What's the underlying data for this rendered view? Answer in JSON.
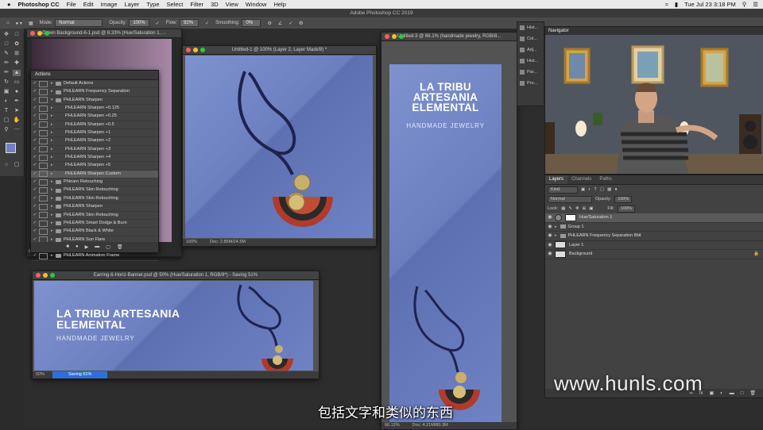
{
  "menubar": {
    "apple": "",
    "app_name": "Photoshop CC",
    "items": [
      "File",
      "Edit",
      "Image",
      "Layer",
      "Type",
      "Select",
      "Filter",
      "3D",
      "View",
      "Window",
      "Help"
    ],
    "clock": "Tue Jul 23  3:18 PM"
  },
  "window_title": "Adobe Photoshop CC 2019",
  "options_bar": {
    "mode_label": "Mode:",
    "mode_value": "Normal",
    "opacity_label": "Opacity:",
    "opacity_value": "100%",
    "flow_label": "Flow:",
    "flow_value": "92%",
    "smoothing_label": "Smoothing:",
    "smoothing_value": "0%"
  },
  "documents": {
    "green_bg": {
      "title": "Green Background-6-1.psd @ 8.33% (Hue/Saturation 1, ...",
      "zoom": "8.33%"
    },
    "untitled1": {
      "title": "Untitled-1 @ 100% (Layer 2, Layer Mask/8) *",
      "zoom": "100%",
      "doc": "Doc: 2.85M/24.5M"
    },
    "untitled3": {
      "title": "Untitled-3 @ 66.1% (handmade jewelry, RGB/8...",
      "zoom": "66.12%",
      "doc": "Doc: 4.21M/80.3M"
    },
    "banner": {
      "title": "Earring-6-Horiz-Banner.psd @ 50% (Hue/Saturation 1, RGB/8*) - Saving 51%",
      "zoom": "50%",
      "saving": "Saving 51%"
    }
  },
  "brand": {
    "title_vertical": "LA TRIBU ARTESANIA ELEMENTAL",
    "title_banner": "LA TRIBU ARTESANIA ELEMENTAL",
    "subtitle": "HANDMADE JEWELRY"
  },
  "actions_panel": {
    "title": "Actions",
    "rows": [
      {
        "label": "Default Actions",
        "kind": "set"
      },
      {
        "label": "PHLEARN Frequency Separation",
        "kind": "set"
      },
      {
        "label": "PHLEARN Sharpen",
        "kind": "set-open"
      },
      {
        "label": "PHLEARN Sharpen +0.125",
        "kind": "action"
      },
      {
        "label": "PHLEARN Sharpen +0.25",
        "kind": "action"
      },
      {
        "label": "PHLEARN Sharpen +0.5",
        "kind": "action"
      },
      {
        "label": "PHLEARN Sharpen +1",
        "kind": "action"
      },
      {
        "label": "PHLEARN Sharpen +2",
        "kind": "action"
      },
      {
        "label": "PHLEARN Sharpen +3",
        "kind": "action"
      },
      {
        "label": "PHLEARN Sharpen +4",
        "kind": "action"
      },
      {
        "label": "PHLEARN Sharpen +5",
        "kind": "action"
      },
      {
        "label": "PHLEARN Sharpen Custom",
        "kind": "action-sel"
      },
      {
        "label": "Phlearn Retouching",
        "kind": "set"
      },
      {
        "label": "PHLEARN Skin Retouching",
        "kind": "set"
      },
      {
        "label": "PHLEARN Skin Retouching",
        "kind": "set"
      },
      {
        "label": "PHLEARN Sharpen",
        "kind": "set"
      },
      {
        "label": "PHLEARN Skin Retouching",
        "kind": "set"
      },
      {
        "label": "PHLEARN Smart Dodge & Burn",
        "kind": "set"
      },
      {
        "label": "PHLEARN Black & White",
        "kind": "set"
      },
      {
        "label": "PHLEARN Sun Flare",
        "kind": "set"
      },
      {
        "label": "PHLEARN Sharpen",
        "kind": "set"
      },
      {
        "label": "PHLEARN Animation Frame",
        "kind": "set"
      }
    ],
    "footer_buttons": [
      "■",
      "●",
      "▶",
      "▬",
      "▢",
      "🗑"
    ]
  },
  "dock": {
    "items": [
      "Hist...",
      "Col...",
      "Adj...",
      "Hist...",
      "Par...",
      "Pro..."
    ]
  },
  "navigator": {
    "title": "Navigator"
  },
  "layers_panel": {
    "tabs": [
      "Layers",
      "Channels",
      "Paths"
    ],
    "kind_label": "Kind",
    "blend_mode": "Normal",
    "opacity_label": "Opacity:",
    "opacity_value": "100%",
    "lock_label": "Lock:",
    "fill_label": "Fill:",
    "fill_value": "100%",
    "layers": [
      {
        "name": "Hue/Saturation 1",
        "kind": "adjustment",
        "selected": true
      },
      {
        "name": "Group 1",
        "kind": "group"
      },
      {
        "name": "PHLEARN Frequency Separation 8bit",
        "kind": "group"
      },
      {
        "name": "Layer 1",
        "kind": "layer"
      },
      {
        "name": "Background",
        "kind": "background"
      }
    ]
  },
  "subtitle": "包括文字和类似的东西",
  "watermark": "www.hunls.com",
  "colors": {
    "canvas_blue": "#6e82c3",
    "traffic_red": "#ff5f57",
    "traffic_yellow": "#febc2e",
    "traffic_green": "#28c840"
  }
}
